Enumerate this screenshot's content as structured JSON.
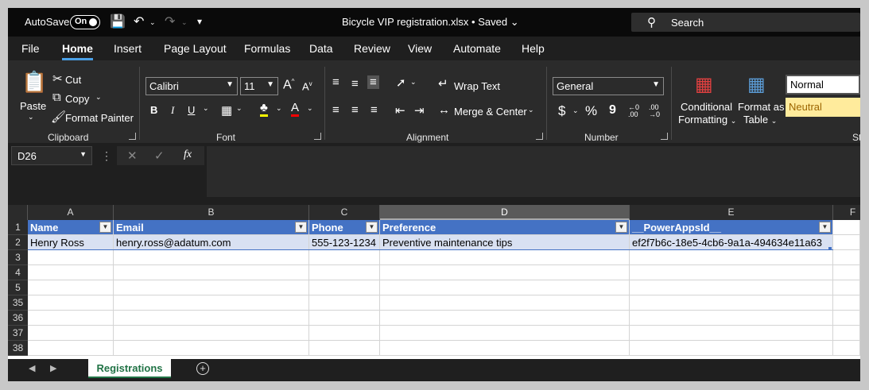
{
  "titlebar": {
    "autosave_label": "AutoSave",
    "autosave_state": "On",
    "document_title": "Bicycle VIP registration.xlsx • Saved",
    "search_placeholder": "Search"
  },
  "menu": {
    "tabs": [
      "File",
      "Home",
      "Insert",
      "Page Layout",
      "Formulas",
      "Data",
      "Review",
      "View",
      "Automate",
      "Help"
    ],
    "active": "Home"
  },
  "ribbon": {
    "clipboard": {
      "paste": "Paste",
      "cut": "Cut",
      "copy": "Copy",
      "format_painter": "Format Painter",
      "label": "Clipboard"
    },
    "font": {
      "family": "Calibri",
      "size": "11",
      "bold": "B",
      "italic": "I",
      "underline": "U",
      "grow": "A",
      "shrink": "A",
      "font_color": "A",
      "label": "Font"
    },
    "alignment": {
      "wrap_text": "Wrap Text",
      "merge_center": "Merge & Center",
      "label": "Alignment"
    },
    "number": {
      "format": "General",
      "currency": "$",
      "percent": "%",
      "comma": "9",
      "inc_decimal": ".00",
      "dec_decimal": ".00",
      "label": "Number"
    },
    "styles": {
      "conditional_line1": "Conditional",
      "conditional_line2": "Formatting",
      "format_table_line1": "Format as",
      "format_table_line2": "Table",
      "normal": "Normal",
      "neutral": "Neutral",
      "label_partial": "St"
    }
  },
  "formula_bar": {
    "name_box": "D26",
    "fx": "fx",
    "value": ""
  },
  "sheet": {
    "columns": [
      "A",
      "B",
      "C",
      "D",
      "E",
      "F"
    ],
    "selected_column": "D",
    "row_numbers": [
      "1",
      "2",
      "3",
      "4",
      "5",
      "35",
      "36",
      "37",
      "38"
    ],
    "headers": [
      "Name",
      "Email",
      "Phone",
      "Preference",
      "__PowerAppsId__"
    ],
    "rows": [
      [
        "Henry Ross",
        "henry.ross@adatum.com",
        "555-123-1234",
        "Preventive maintenance tips",
        "ef2f7b6c-18e5-4cb6-9a1a-494634e11a63"
      ]
    ]
  },
  "sheet_tabs": {
    "active": "Registrations",
    "add": "+"
  },
  "colors": {
    "table_header": "#4472c4",
    "table_band": "#d9e1f2",
    "accent": "#217346",
    "neutral_fill": "#ffeb9c"
  }
}
